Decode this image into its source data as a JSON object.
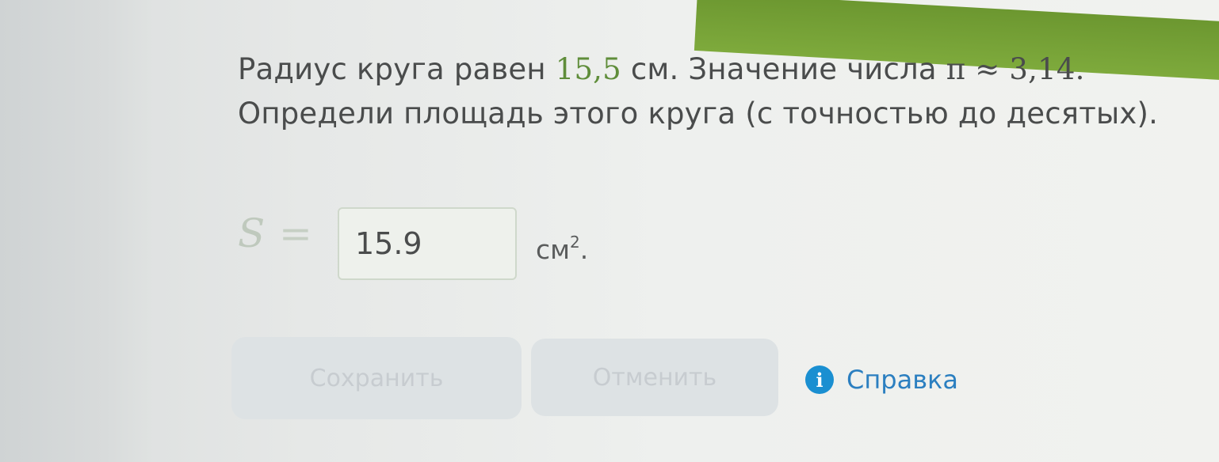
{
  "question": {
    "line1_prefix": "Радиус круга равен ",
    "radius_value": "15,5",
    "line1_mid": " см. Значение числа ",
    "pi_symbol": "π",
    "approx_symbol": " ≈ ",
    "pi_value": "3,14.",
    "line2": "Определи площадь этого круга (с точностью до десятых)."
  },
  "answer": {
    "variable": "S",
    "equals": "=",
    "value": "15.9",
    "unit": "см",
    "unit_exponent": "2",
    "unit_suffix": "."
  },
  "buttons": {
    "save_label": "Сохранить",
    "cancel_label": "Отменить"
  },
  "help": {
    "icon": "info-icon",
    "icon_glyph": "i",
    "label": "Справка"
  },
  "colors": {
    "math_green": "#5f8d3a",
    "help_blue": "#2b7fc0",
    "info_icon_bg": "#1a8fd1",
    "top_bar_green": "#7eaa3c"
  }
}
